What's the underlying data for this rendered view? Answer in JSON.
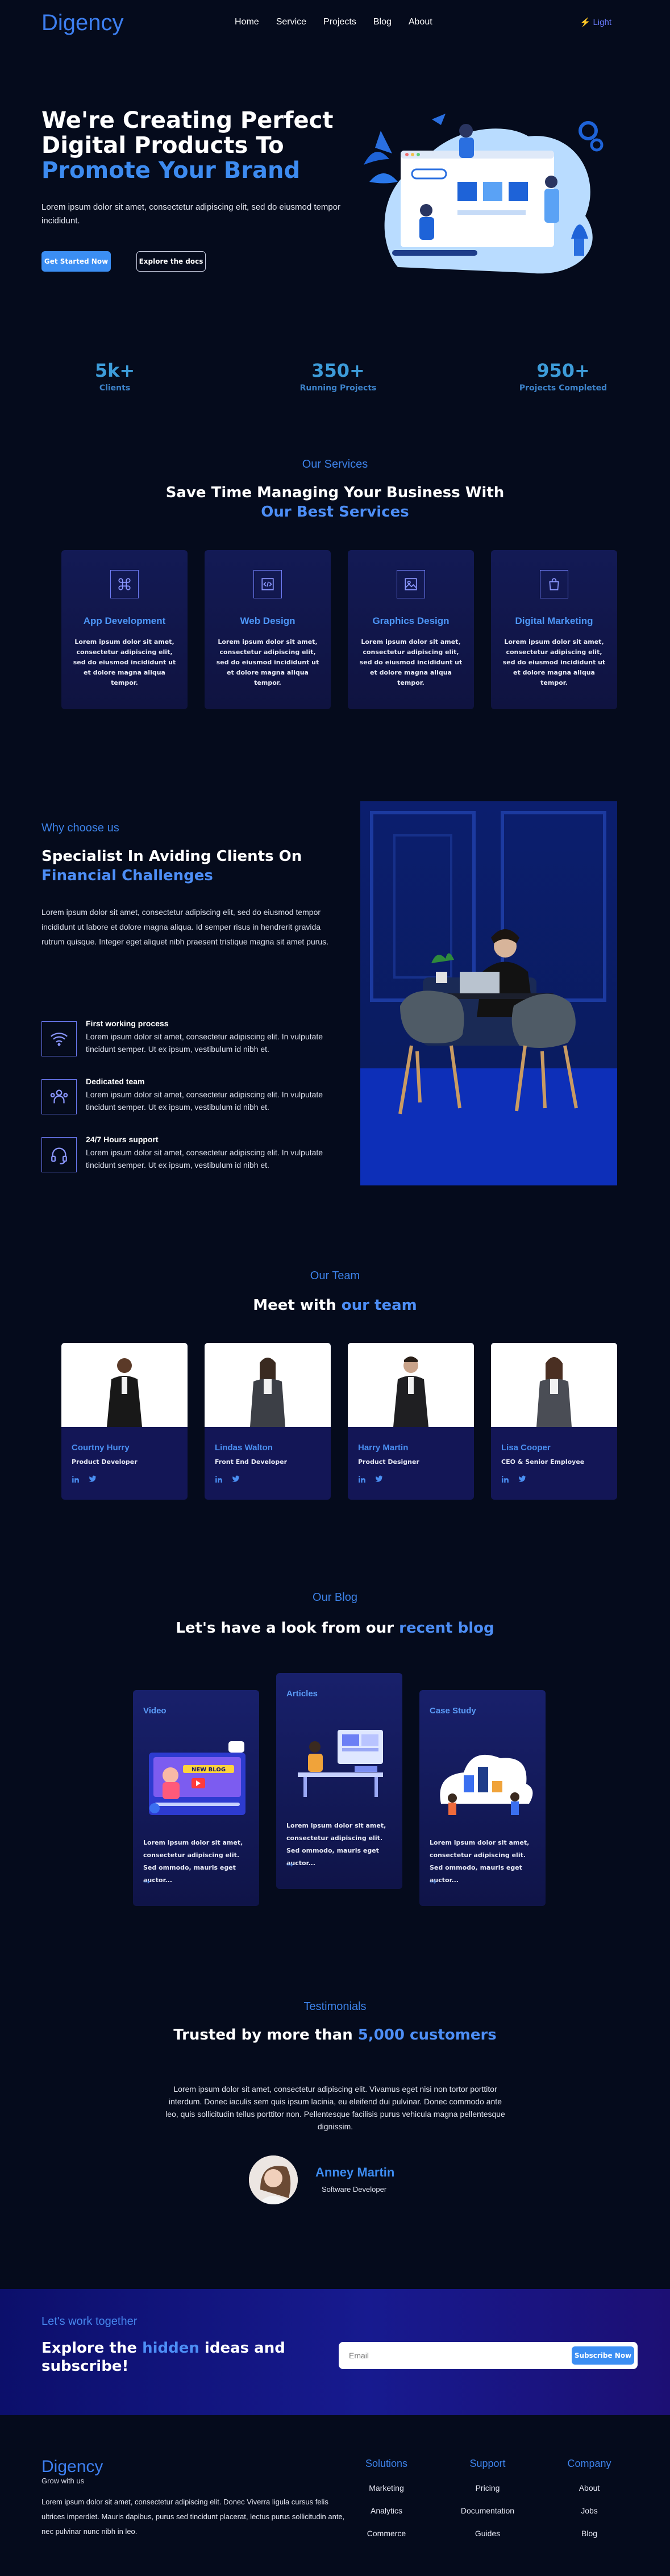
{
  "nav": {
    "logo": "Digency",
    "links": [
      "Home",
      "Service",
      "Projects",
      "Blog",
      "About"
    ],
    "theme_toggle": "Light"
  },
  "hero": {
    "title_line1": "We're Creating Perfect",
    "title_line2": "Digital Products To",
    "title_line3": "Promote Your Brand",
    "description": "Lorem ipsum dolor sit amet, consectetur adipiscing elit, sed do eiusmod tempor incididunt.",
    "primary_button": "Get Started Now",
    "secondary_button": "Explore the docs"
  },
  "stats": [
    {
      "value": "5k+",
      "label": "Clients"
    },
    {
      "value": "350+",
      "label": "Running Projects"
    },
    {
      "value": "950+",
      "label": "Projects Completed"
    }
  ],
  "services": {
    "kicker": "Our Services",
    "title_a": "Save Time Managing Your Business With",
    "title_b": "Our Best Services",
    "items": [
      {
        "title": "App Development",
        "icon": "command-icon",
        "desc": "Lorem ipsum dolor sit amet, consectetur adipiscing elit, sed do eiusmod incididunt ut et dolore magna aliqua tempor."
      },
      {
        "title": "Web Design",
        "icon": "code-icon",
        "desc": "Lorem ipsum dolor sit amet, consectetur adipiscing elit, sed do eiusmod incididunt ut et dolore magna aliqua tempor."
      },
      {
        "title": "Graphics Design",
        "icon": "image-icon",
        "desc": "Lorem ipsum dolor sit amet, consectetur adipiscing elit, sed do eiusmod incididunt ut et dolore magna aliqua tempor."
      },
      {
        "title": "Digital Marketing",
        "icon": "bag-icon",
        "desc": "Lorem ipsum dolor sit amet, consectetur adipiscing elit, sed do eiusmod incididunt ut et dolore magna aliqua tempor."
      }
    ]
  },
  "why": {
    "kicker": "Why choose us",
    "title_a": "Specialist In Aviding Clients On",
    "title_b": "Financial Challenges",
    "description": "Lorem ipsum dolor sit amet, consectetur adipiscing elit, sed do eiusmod tempor incididunt ut labore et dolore magna aliqua. Id semper risus in hendrerit gravida rutrum quisque. Integer eget aliquet nibh praesent tristique magna sit amet purus.",
    "features": [
      {
        "title": "First working process",
        "icon": "wifi-icon",
        "desc": "Lorem ipsum dolor sit amet, consectetur adipiscing elit. In vulputate tincidunt semper. Ut ex ipsum, vestibulum id nibh et."
      },
      {
        "title": "Dedicated team",
        "icon": "team-icon",
        "desc": "Lorem ipsum dolor sit amet, consectetur adipiscing elit. In vulputate tincidunt semper. Ut ex ipsum, vestibulum id nibh et."
      },
      {
        "title": "24/7 Hours support",
        "icon": "headset-icon",
        "desc": "Lorem ipsum dolor sit amet, consectetur adipiscing elit. In vulputate tincidunt semper. Ut ex ipsum, vestibulum id nibh et."
      }
    ]
  },
  "team": {
    "kicker": "Our Team",
    "title_a": "Meet with",
    "title_b": "our team",
    "members": [
      {
        "name": "Courtny Hurry",
        "role": "Product Developer"
      },
      {
        "name": "Lindas Walton",
        "role": "Front End Developer"
      },
      {
        "name": "Harry Martin",
        "role": "Product Designer"
      },
      {
        "name": "Lisa Cooper",
        "role": "CEO & Senior Employee"
      }
    ]
  },
  "blog": {
    "kicker": "Our Blog",
    "title_a": "Let's have a look from our",
    "title_b": "recent blog",
    "posts": [
      {
        "tag": "Video",
        "desc": "Lorem ipsum dolor sit amet, consectetur adipiscing elit. Sed ommodo, mauris eget auctor...",
        "img_text": "NEW BLOG"
      },
      {
        "tag": "Articles",
        "desc": "Lorem ipsum dolor sit amet, consectetur adipiscing elit. Sed ommodo, mauris eget auctor..."
      },
      {
        "tag": "Case Study",
        "desc": "Lorem ipsum dolor sit amet, consectetur adipiscing elit. Sed ommodo, mauris eget auctor..."
      }
    ],
    "arrow": "→"
  },
  "testimonials": {
    "kicker": "Testimonials",
    "title_a": "Trusted by more than",
    "title_b": "5,000 customers",
    "quote": "Lorem ipsum dolor sit amet, consectetur adipiscing elit. Vivamus eget nisi non tortor porttitor interdum. Donec iaculis sem quis ipsum lacinia, eu eleifend dui pulvinar. Donec commodo ante leo, quis sollicitudin tellus porttitor non. Pellentesque facilisis purus vehicula magna pellentesque dignissim.",
    "name": "Anney Martin",
    "role": "Software Developer"
  },
  "cta": {
    "kicker": "Let's work together",
    "title_a": "Explore the",
    "title_b": "hidden",
    "title_c": "ideas and subscribe!",
    "email_placeholder": "Email",
    "button": "Subscribe Now"
  },
  "footer": {
    "logo": "Digency",
    "tagline": "Grow with us",
    "description": "Lorem ipsum dolor sit amet, consectetur adipiscing elit. Donec Viverra ligula cursus felis ultrices imperdiet. Mauris dapibus, purus sed tincidunt placerat, lectus purus sollicitudin ante, nec pulvinar nunc nibh in leo.",
    "columns": [
      {
        "heading": "Solutions",
        "links": [
          "Marketing",
          "Analytics",
          "Commerce"
        ]
      },
      {
        "heading": "Support",
        "links": [
          "Pricing",
          "Documentation",
          "Guides"
        ]
      },
      {
        "heading": "Company",
        "links": [
          "About",
          "Jobs",
          "Blog"
        ]
      }
    ]
  },
  "colors": {
    "accent": "#3b8ef3",
    "bg": "#050b1c",
    "card": "#131a55"
  }
}
